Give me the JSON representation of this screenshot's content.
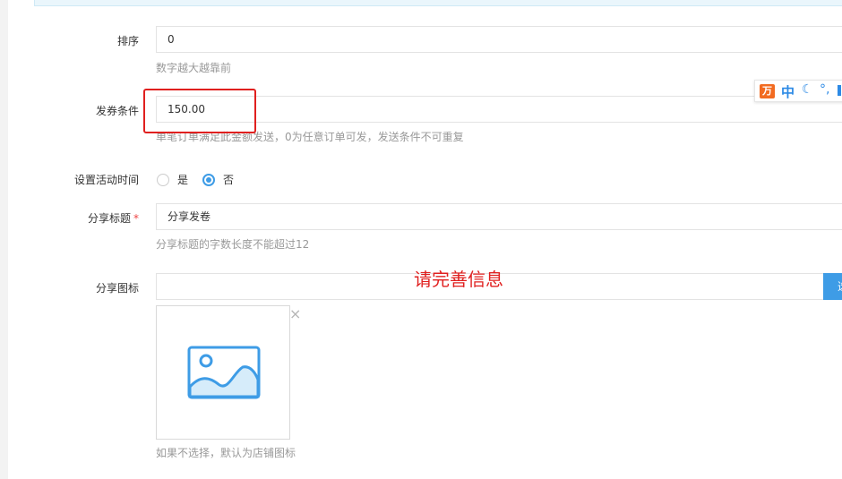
{
  "form": {
    "sort": {
      "label": "排序",
      "value": "0",
      "help": "数字越大越靠前"
    },
    "condition": {
      "label": "发券条件",
      "value": "150.00",
      "help": "单笔订单满足此金额发送，0为任意订单可发，发送条件不可重复"
    },
    "activity_time": {
      "label": "设置活动时间",
      "options": [
        "是",
        "否"
      ],
      "selected": "否"
    },
    "share_title": {
      "label": "分享标题",
      "required_mark": "*",
      "value": "分享发卷",
      "help": "分享标题的字数长度不能超过12"
    },
    "share_icon": {
      "label": "分享图标",
      "value": "",
      "select_button": "选",
      "help": "如果不选择，默认为店铺图标",
      "remove_symbol": "×"
    }
  },
  "validation_message": "请完善信息",
  "ime_toolbar": {
    "logo": "万",
    "mode": "中",
    "icons": [
      "moon-icon",
      "punctuation-icon",
      "menu-icon"
    ]
  },
  "colors": {
    "accent": "#3e9ce6",
    "error": "#e0201f",
    "required": "#e44444"
  }
}
